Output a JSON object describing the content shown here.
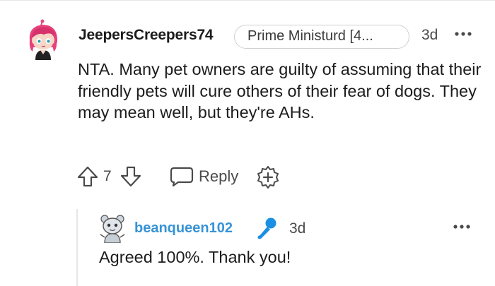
{
  "comment": {
    "username": "JeepersCreepers74",
    "flair": "Prime Ministurd [4...",
    "time": "3d",
    "body": "NTA. Many pet owners are guilty of assuming that their friendly pets will cure others of their fear of dogs. They may mean well, but they're AHs.",
    "vote_count": "7",
    "reply_label": "Reply",
    "icons": {
      "more": "more-options-icon",
      "upvote": "upvote-arrow-icon",
      "downvote": "downvote-arrow-icon",
      "reply": "speech-bubble-icon",
      "award": "award-plus-icon"
    }
  },
  "reply": {
    "username": "beanqueen102",
    "time": "3d",
    "body": "Agreed 100%. Thank you!",
    "icons": {
      "badge": "microphone-icon",
      "more": "more-options-icon"
    }
  },
  "colors": {
    "username_reply": "#3793d6",
    "mic_badge": "#1a8fe3",
    "text_primary": "#1c1c1c",
    "text_meta": "#4a4a4a",
    "border": "#cfcfcf"
  }
}
